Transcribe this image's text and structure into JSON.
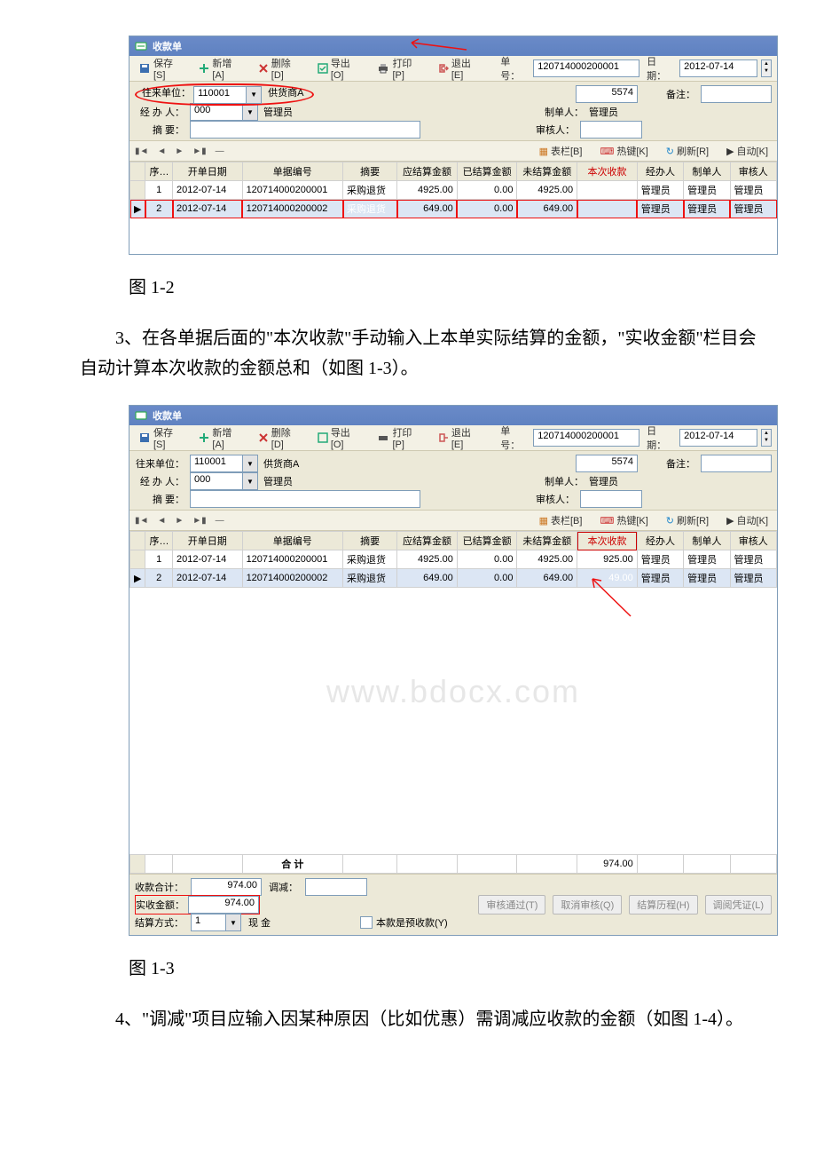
{
  "captions": {
    "fig12": "图 1-2",
    "para3": "3、在各单据后面的\"本次收款\"手动输入上本单实际结算的金额，\"实收金额\"栏目会自动计算本次收款的金额总和（如图 1-3）。",
    "fig13": "图 1-3",
    "para4": "4、\"调减\"项目应输入因某种原因（比如优惠）需调减应收款的金额（如图 1-4）。"
  },
  "app": {
    "title": "收款单",
    "watermark": "www.bdocx.com",
    "toolbar": {
      "save": "保存[S]",
      "add": "新增[A]",
      "del": "删除[D]",
      "export": "导出[O]",
      "print": "打印[P]",
      "exit": "退出[E]",
      "docno_label": "单号：",
      "docno": "120714000200001",
      "date_label": "日期：",
      "date": "2012-07-14"
    },
    "form": {
      "partner_label": "往来单位：",
      "partner_code": "110001",
      "partner_name": "供货商A",
      "number": "5574",
      "remark_label": "备注：",
      "operator_label": "经 办 人：",
      "operator_code": "000",
      "operator_name": "管理员",
      "maker_label": "制单人：",
      "maker_name": "管理员",
      "summary_label": "摘    要：",
      "auditor_label": "审核人："
    },
    "nav_right": {
      "cols": "表栏[B]",
      "hotkey": "热键[K]",
      "refresh": "刷新[R]",
      "auto": "自动[K]"
    },
    "columns": {
      "seq": "序号",
      "date": "开单日期",
      "docno": "单据编号",
      "summary": "摘要",
      "due": "应结算金额",
      "paid": "已结算金额",
      "unpaid": "未结算金额",
      "this": "本次收款",
      "operator": "经办人",
      "maker": "制单人",
      "auditor": "审核人"
    }
  },
  "fig12_rows": [
    {
      "seq": "1",
      "date": "2012-07-14",
      "docno": "120714000200001",
      "summary": "采购退货",
      "due": "4925.00",
      "paid": "0.00",
      "unpaid": "4925.00",
      "this": "",
      "op": "管理员",
      "mk": "管理员",
      "au": "管理员"
    },
    {
      "seq": "2",
      "date": "2012-07-14",
      "docno": "120714000200002",
      "summary": "采购退货",
      "due": "649.00",
      "paid": "0.00",
      "unpaid": "649.00",
      "this": "",
      "op": "管理员",
      "mk": "管理员",
      "au": "管理员"
    }
  ],
  "fig13_rows": [
    {
      "seq": "1",
      "date": "2012-07-14",
      "docno": "120714000200001",
      "summary": "采购退货",
      "due": "4925.00",
      "paid": "0.00",
      "unpaid": "4925.00",
      "this": "925.00",
      "op": "管理员",
      "mk": "管理员",
      "au": "管理员"
    },
    {
      "seq": "2",
      "date": "2012-07-14",
      "docno": "120714000200002",
      "summary": "采购退货",
      "due": "649.00",
      "paid": "0.00",
      "unpaid": "649.00",
      "this": "49.00",
      "op": "管理员",
      "mk": "管理员",
      "au": "管理员"
    }
  ],
  "fig13_total_row": {
    "label": "合 计",
    "this_total": "974.00"
  },
  "footer": {
    "receipt_total_label": "收款合计：",
    "receipt_total": "974.00",
    "adjust_label": "调减：",
    "adjust": "",
    "actual_label": "实收金额：",
    "actual": "974.00",
    "method_label": "结算方式：",
    "method_code": "1",
    "method_name": "现 金",
    "prepay_label": "本款是预收款(Y)",
    "btn_approve": "审核通过(T)",
    "btn_cancel": "取消审核(Q)",
    "btn_history": "结算历程(H)",
    "btn_voucher": "调阅凭证(L)"
  }
}
